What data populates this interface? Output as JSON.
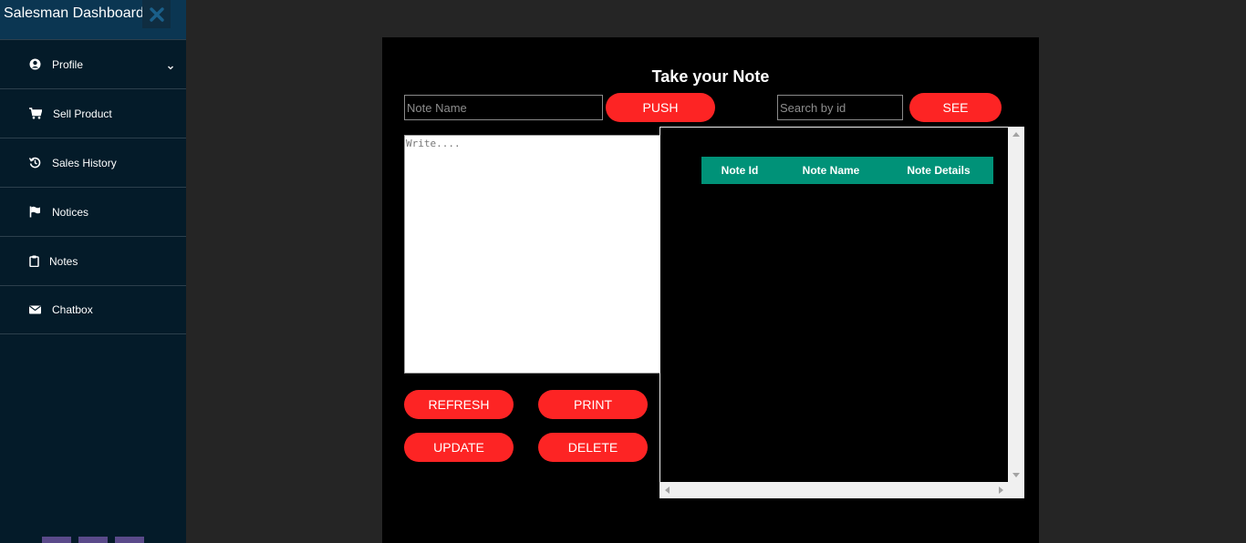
{
  "sidebar": {
    "title": "Salesman Dashboard",
    "items": [
      {
        "label": "Profile",
        "icon": "user-circle-icon",
        "has_chevron": true
      },
      {
        "label": "Sell Product",
        "icon": "cart-icon"
      },
      {
        "label": "Sales History",
        "icon": "history-icon"
      },
      {
        "label": "Notices",
        "icon": "flag-icon"
      },
      {
        "label": "Notes",
        "icon": "clipboard-icon"
      },
      {
        "label": "Chatbox",
        "icon": "envelope-icon"
      }
    ]
  },
  "note_panel": {
    "title": "Take your Note",
    "note_name_placeholder": "Note Name",
    "push_label": "PUSH",
    "search_placeholder": "Search by id",
    "see_label": "SEE",
    "write_placeholder": "Write....",
    "refresh_label": "REFRESH",
    "print_label": "PRINT",
    "update_label": "UPDATE",
    "delete_label": "DELETE",
    "table_headers": [
      "Note Id",
      "Note Name",
      "Note Details"
    ]
  },
  "colors": {
    "sidebar_bg": "#041b29",
    "sidebar_header": "#0b3652",
    "page_bg": "#252525",
    "panel_bg": "#000000",
    "button_red": "#fd2424",
    "table_header": "#009278"
  }
}
